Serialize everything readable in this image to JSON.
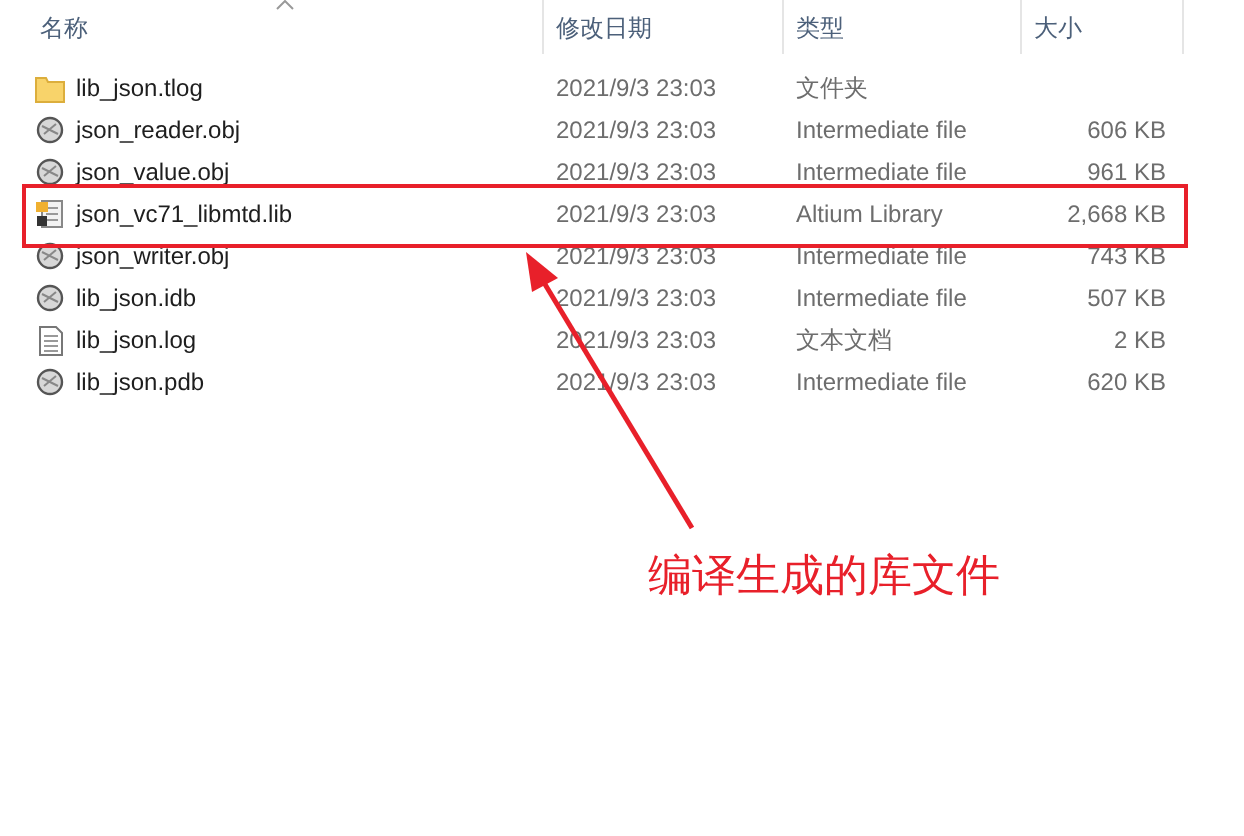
{
  "columns": [
    {
      "label": "名称",
      "sorted": true
    },
    {
      "label": "修改日期",
      "sorted": false
    },
    {
      "label": "类型",
      "sorted": false
    },
    {
      "label": "大小",
      "sorted": false
    }
  ],
  "rows": [
    {
      "kind": "folder",
      "name": "lib_json.tlog",
      "date": "2021/9/3 23:03",
      "type": "文件夹"
    },
    {
      "kind": "obj",
      "name": "json_reader.obj",
      "date": "2021/9/3 23:03",
      "type": "Intermediate file",
      "size": "606 KB"
    },
    {
      "kind": "obj",
      "name": "json_value.obj",
      "date": "2021/9/3 23:03",
      "type": "Intermediate file",
      "size": "961 KB"
    },
    {
      "kind": "lib",
      "name": "json_vc71_libmtd.lib",
      "date": "2021/9/3 23:03",
      "type": "Altium Library",
      "size": "2,668 KB"
    },
    {
      "kind": "obj",
      "name": "json_writer.obj",
      "date": "2021/9/3 23:03",
      "type": "Intermediate file",
      "size": "743 KB"
    },
    {
      "kind": "obj",
      "name": "lib_json.idb",
      "date": "2021/9/3 23:03",
      "type": "Intermediate file",
      "size": "507 KB"
    },
    {
      "kind": "text",
      "name": "lib_json.log",
      "date": "2021/9/3 23:03",
      "type": "文本文档",
      "size": "2 KB"
    },
    {
      "kind": "obj",
      "name": "lib_json.pdb",
      "date": "2021/9/3 23:03",
      "type": "Intermediate file",
      "size": "620 KB"
    }
  ],
  "annotation": {
    "text": "编译生成的库文件"
  }
}
